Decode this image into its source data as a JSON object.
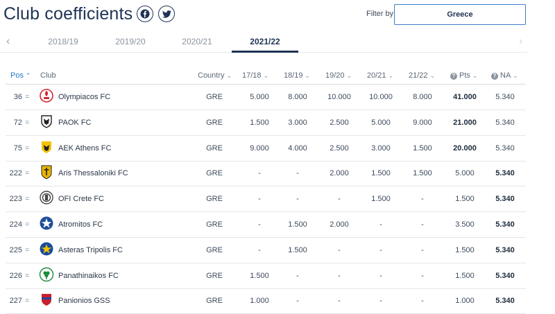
{
  "header": {
    "title": "Club coefficients",
    "filter_label": "Filter by",
    "filter_value": "Greece",
    "social": [
      "facebook-icon",
      "twitter-icon"
    ]
  },
  "seasons": {
    "tabs": [
      "2018/19",
      "2019/20",
      "2020/21",
      "2021/22"
    ],
    "active": "2021/22"
  },
  "table": {
    "columns": [
      "Pos",
      "Club",
      "Country",
      "17/18",
      "18/19",
      "19/20",
      "20/21",
      "21/22",
      "Pts",
      "NA"
    ],
    "sorted_column": "Pos",
    "rows": [
      {
        "pos": "36",
        "change": "=",
        "club": "Olympiacos FC",
        "country": "GRE",
        "s1": "5.000",
        "s2": "8.000",
        "s3": "10.000",
        "s4": "10.000",
        "s5": "8.000",
        "pts": "41.000",
        "na": "5.340",
        "logo_color": "#d32630",
        "logo": "olympiacos-logo"
      },
      {
        "pos": "72",
        "change": "=",
        "club": "PAOK FC",
        "country": "GRE",
        "s1": "1.500",
        "s2": "3.000",
        "s3": "2.500",
        "s4": "5.000",
        "s5": "9.000",
        "pts": "21.000",
        "na": "5.340",
        "logo_color": "#222222",
        "logo": "paok-logo"
      },
      {
        "pos": "75",
        "change": "=",
        "club": "AEK Athens FC",
        "country": "GRE",
        "s1": "9.000",
        "s2": "4.000",
        "s3": "2.500",
        "s4": "3.000",
        "s5": "1.500",
        "pts": "20.000",
        "na": "5.340",
        "logo_color": "#f2c200",
        "logo": "aek-logo"
      },
      {
        "pos": "222",
        "change": "=",
        "club": "Aris Thessaloniki FC",
        "country": "GRE",
        "s1": "-",
        "s2": "-",
        "s3": "2.000",
        "s4": "1.500",
        "s5": "1.500",
        "pts": "5.000",
        "na": "5.340",
        "logo_color": "#e8b400",
        "logo": "aris-logo"
      },
      {
        "pos": "223",
        "change": "=",
        "club": "OFI Crete FC",
        "country": "GRE",
        "s1": "-",
        "s2": "-",
        "s3": "-",
        "s4": "1.500",
        "s5": "-",
        "pts": "1.500",
        "na": "5.340",
        "logo_color": "#444444",
        "logo": "ofi-logo"
      },
      {
        "pos": "224",
        "change": "=",
        "club": "Atromitos FC",
        "country": "GRE",
        "s1": "-",
        "s2": "1.500",
        "s3": "2.000",
        "s4": "-",
        "s5": "-",
        "pts": "3.500",
        "na": "5.340",
        "logo_color": "#1f4f9a",
        "logo": "atromitos-logo"
      },
      {
        "pos": "225",
        "change": "=",
        "club": "Asteras Tripolis FC",
        "country": "GRE",
        "s1": "-",
        "s2": "1.500",
        "s3": "-",
        "s4": "-",
        "s5": "-",
        "pts": "1.500",
        "na": "5.340",
        "logo_color": "#1a4b9c",
        "logo": "asteras-logo"
      },
      {
        "pos": "226",
        "change": "=",
        "club": "Panathinaikos FC",
        "country": "GRE",
        "s1": "1.500",
        "s2": "-",
        "s3": "-",
        "s4": "-",
        "s5": "-",
        "pts": "1.500",
        "na": "5.340",
        "logo_color": "#1c8c3c",
        "logo": "panathinaikos-logo"
      },
      {
        "pos": "227",
        "change": "=",
        "club": "Panionios GSS",
        "country": "GRE",
        "s1": "1.000",
        "s2": "-",
        "s3": "-",
        "s4": "-",
        "s5": "-",
        "pts": "1.000",
        "na": "5.340",
        "logo_color": "#c8202e",
        "logo": "panionios-logo"
      }
    ]
  }
}
